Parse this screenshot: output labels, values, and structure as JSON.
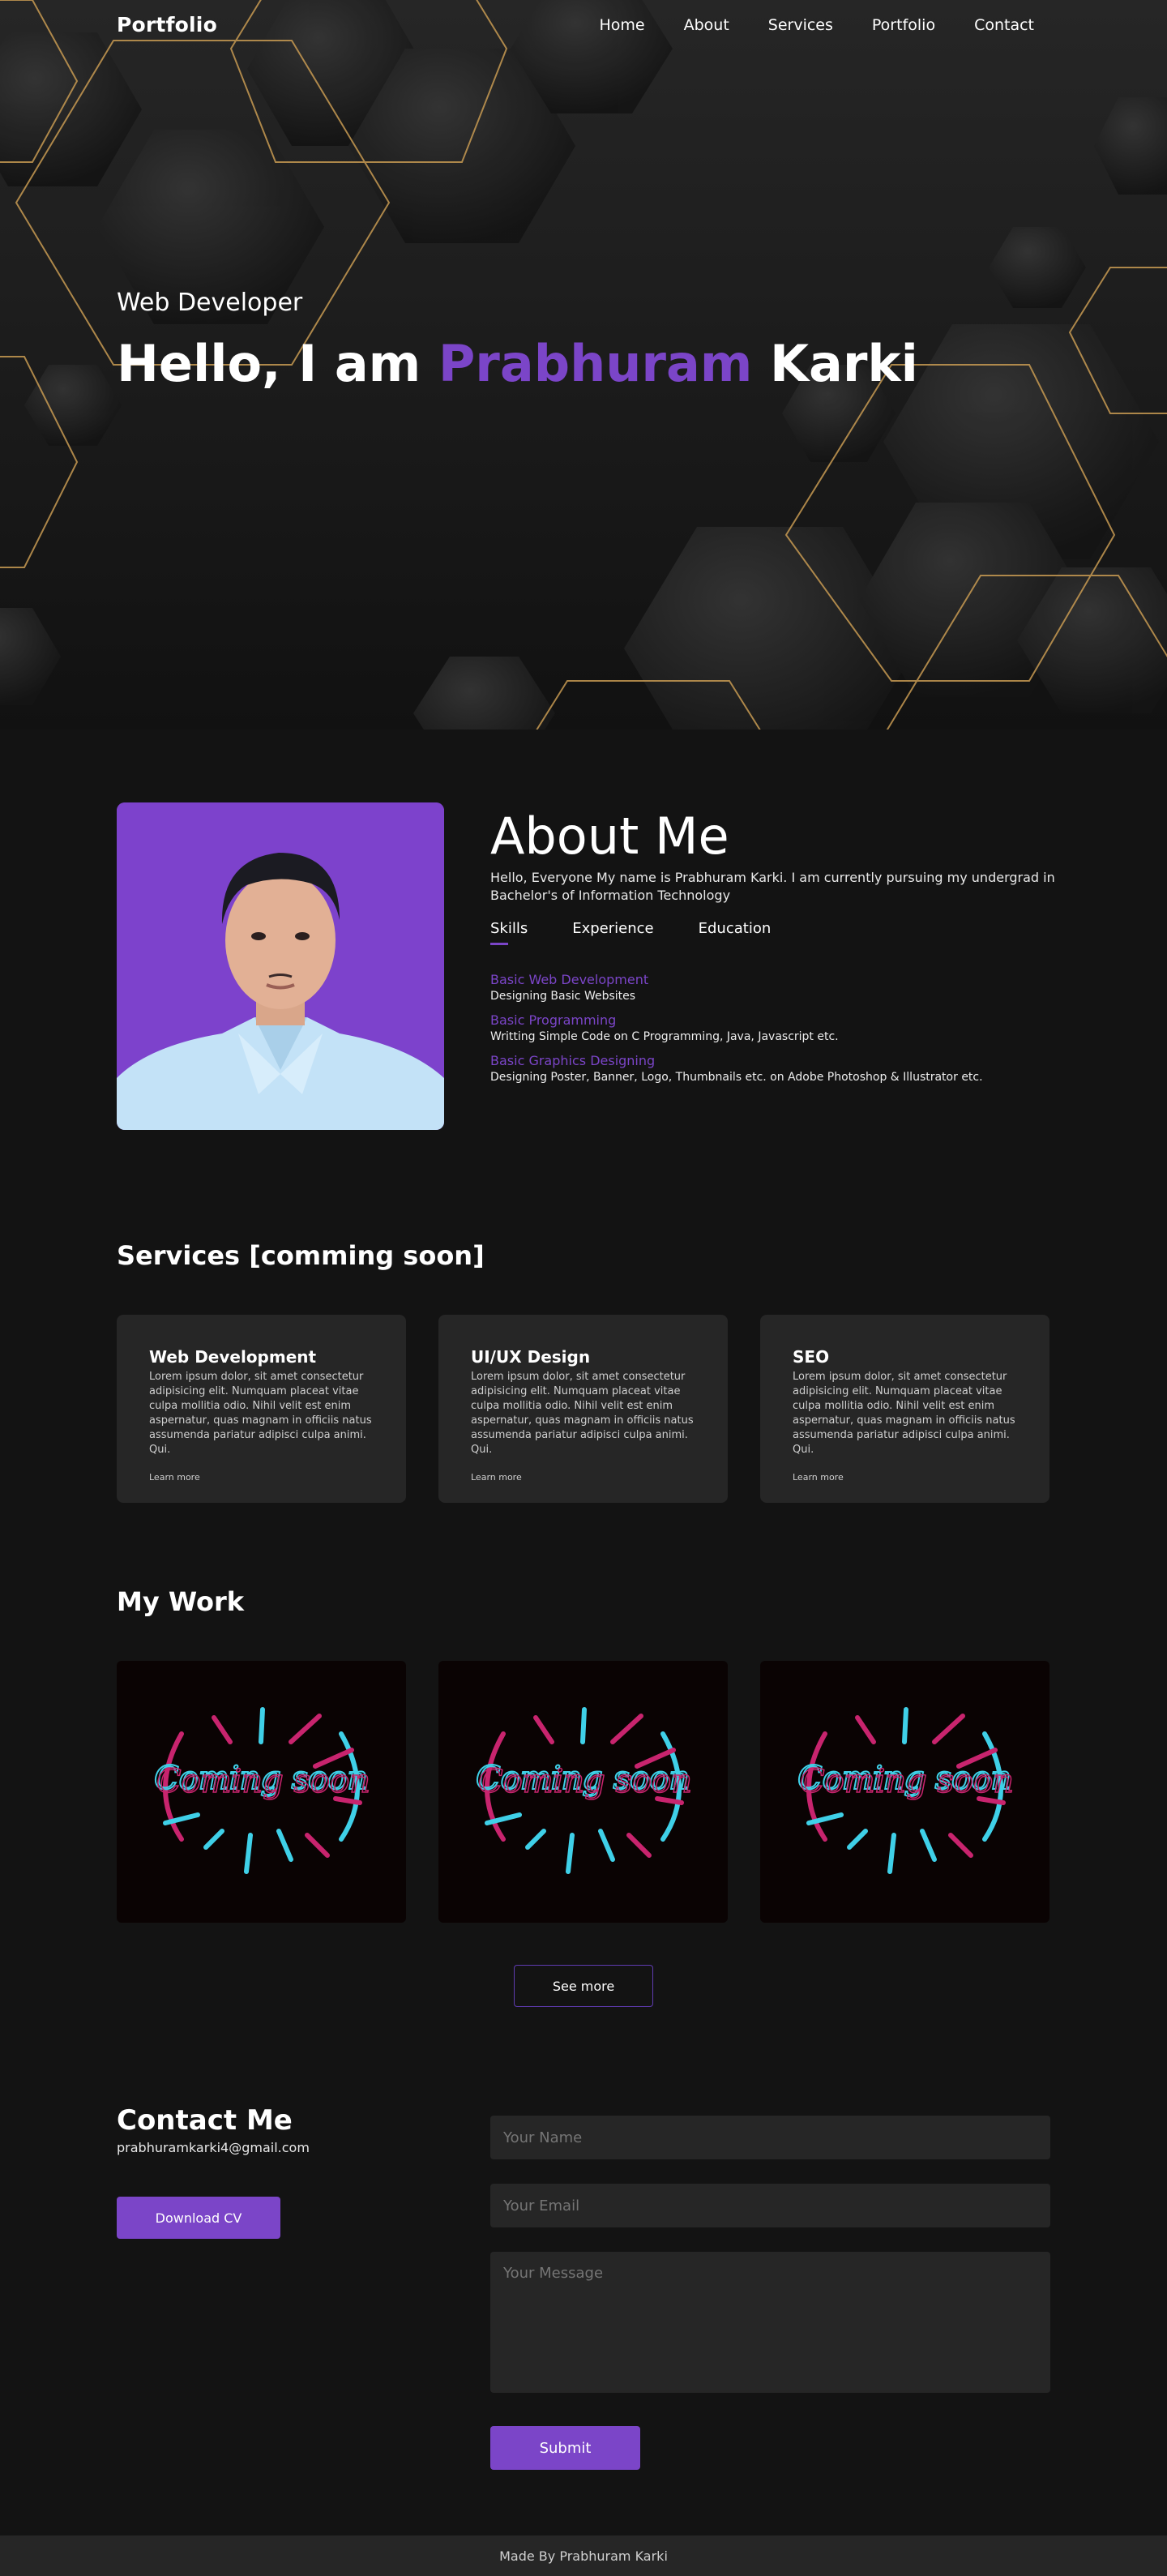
{
  "nav": {
    "logo": "Portfolio",
    "items": [
      "Home",
      "About",
      "Services",
      "Portfolio",
      "Contact"
    ]
  },
  "hero": {
    "subtitle": "Web Developer",
    "headline_prefix": "Hello, I am ",
    "headline_accent": "Prabhuram",
    "headline_suffix": " Karki"
  },
  "about": {
    "title": "About Me",
    "text": "Hello, Everyone My name is Prabhuram Karki. I am currently pursuing my undergrad in Bachelor's of Information Technology",
    "tabs": [
      "Skills",
      "Experience",
      "Education"
    ],
    "skills": [
      {
        "title": "Basic Web Development",
        "desc": "Designing Basic Websites"
      },
      {
        "title": "Basic Programming",
        "desc": "Writting Simple Code on C Programming, Java, Javascript etc."
      },
      {
        "title": "Basic Graphics Designing",
        "desc": "Designing Poster, Banner, Logo, Thumbnails etc. on Adobe Photoshop & Illustrator etc."
      }
    ]
  },
  "services": {
    "title": "Services [comming soon]",
    "cards": [
      {
        "title": "Web Development",
        "text": "Lorem ipsum dolor, sit amet consectetur adipisicing elit. Numquam placeat vitae culpa mollitia odio. Nihil velit est enim aspernatur, quas magnam in officiis natus assumenda pariatur adipisci culpa animi. Qui.",
        "link": "Learn more"
      },
      {
        "title": "UI/UX Design",
        "text": "Lorem ipsum dolor, sit amet consectetur adipisicing elit. Numquam placeat vitae culpa mollitia odio. Nihil velit est enim aspernatur, quas magnam in officiis natus assumenda pariatur adipisci culpa animi. Qui.",
        "link": "Learn more"
      },
      {
        "title": "SEO",
        "text": "Lorem ipsum dolor, sit amet consectetur adipisicing elit. Numquam placeat vitae culpa mollitia odio. Nihil velit est enim aspernatur, quas magnam in officiis natus assumenda pariatur adipisci culpa animi. Qui.",
        "link": "Learn more"
      }
    ]
  },
  "work": {
    "title": "My Work",
    "image_label": "Coming soon",
    "see_more": "See more"
  },
  "contact": {
    "title": "Contact Me",
    "email": "prabhuramkarki4@gmail.com",
    "download": "Download CV",
    "name_placeholder": "Your Name",
    "email_placeholder": "Your Email",
    "message_placeholder": "Your Message",
    "submit": "Submit"
  },
  "footer": {
    "text": "Made By Prabhuram Karki"
  },
  "colors": {
    "accent": "#7b45c8",
    "background": "#131313",
    "card": "#262626",
    "hex_outline": "#c79a52"
  }
}
